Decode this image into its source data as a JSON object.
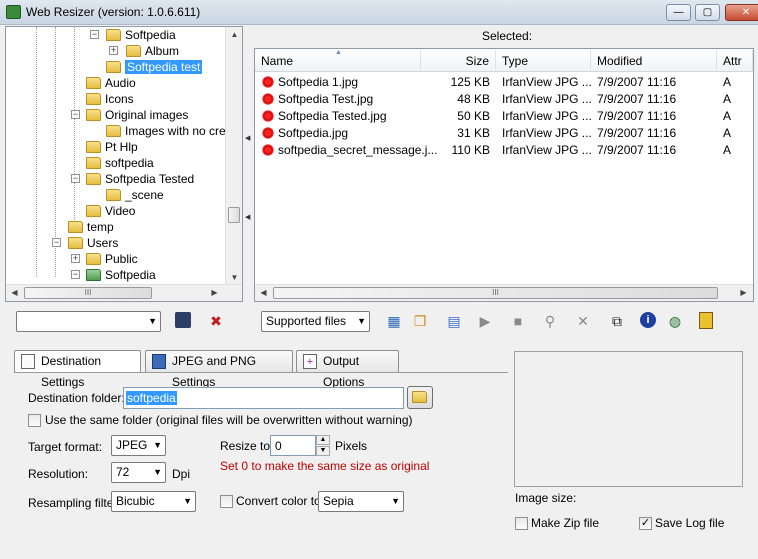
{
  "window": {
    "title": "Web Resizer (version: 1.0.6.611)",
    "minimize": "—",
    "maximize": "▢",
    "close": "✕"
  },
  "tree": {
    "items": [
      {
        "label": "Softpedia"
      },
      {
        "label": "Album"
      },
      {
        "label": "Softpedia test",
        "selected": true
      },
      {
        "label": "Audio"
      },
      {
        "label": "Icons"
      },
      {
        "label": "Original images"
      },
      {
        "label": "Images with no creati"
      },
      {
        "label": "Pt Hlp"
      },
      {
        "label": "softpedia"
      },
      {
        "label": "Softpedia Tested"
      },
      {
        "label": "_scene"
      },
      {
        "label": "Video"
      },
      {
        "label": "temp"
      },
      {
        "label": "Users"
      },
      {
        "label": "Public"
      },
      {
        "label": "Softpedia"
      }
    ],
    "hscroll_grip": "III"
  },
  "files": {
    "selected_label": "Selected:",
    "sort_indicator": "▲",
    "columns": [
      "Name",
      "Size",
      "Type",
      "Modified",
      "Attr"
    ],
    "rows": [
      {
        "name": "Softpedia 1.jpg",
        "size": "125 KB",
        "type": "IrfanView JPG ...",
        "modified": "7/9/2007 11:16",
        "attr": "A"
      },
      {
        "name": "Softpedia Test.jpg",
        "size": "48 KB",
        "type": "IrfanView JPG ...",
        "modified": "7/9/2007 11:16",
        "attr": "A"
      },
      {
        "name": "Softpedia Tested.jpg",
        "size": "50 KB",
        "type": "IrfanView JPG ...",
        "modified": "7/9/2007 11:16",
        "attr": "A"
      },
      {
        "name": "Softpedia.jpg",
        "size": "31 KB",
        "type": "IrfanView JPG ...",
        "modified": "7/9/2007 11:16",
        "attr": "A"
      },
      {
        "name": "softpedia_secret_message.j...",
        "size": "110 KB",
        "type": "IrfanView JPG ...",
        "modified": "7/9/2007 11:16",
        "attr": "A"
      }
    ],
    "hscroll_grip": "III"
  },
  "toolbar": {
    "preset_value": "",
    "filter_value": "Supported files",
    "icons": [
      "save-icon",
      "delete-preset-icon",
      "thumbnails-view-icon",
      "copy-icon",
      "paste-icon",
      "play-icon",
      "stop-icon",
      "zoom-icon",
      "remove-icon",
      "select-all-icon",
      "info-icon",
      "web-icon",
      "exit-icon"
    ]
  },
  "tabs": [
    {
      "label": "Destination Settings",
      "active": true
    },
    {
      "label": "JPEG and PNG Settings",
      "active": false
    },
    {
      "label": "Output Options",
      "active": false
    }
  ],
  "settings": {
    "dest_folder_label": "Destination folder:",
    "dest_folder_value": "softpedia",
    "same_folder_label": "Use the same folder (original files will be overwritten without warning)",
    "same_folder_checked": false,
    "target_format_label": "Target format:",
    "target_format_value": "JPEG",
    "resolution_label": "Resolution:",
    "resolution_value": "72",
    "resolution_unit": "Dpi",
    "resampling_label": "Resampling filter:",
    "resampling_value": "Bicubic",
    "resize_label": "Resize to:",
    "resize_value": "0",
    "resize_unit": "Pixels",
    "resize_hint": "Set 0 to make the same size as original",
    "convert_color_label": "Convert color to:",
    "convert_color_checked": false,
    "convert_color_value": "Sepia"
  },
  "preview": {
    "image_size_label": "Image size:",
    "make_zip_label": "Make Zip file",
    "make_zip_checked": false,
    "save_log_label": "Save Log file",
    "save_log_checked": true,
    "check_mark": "✓"
  },
  "colors": {
    "selection": "#3399ff",
    "hint_text": "#c00000",
    "jpg_icon": "#e02020"
  }
}
